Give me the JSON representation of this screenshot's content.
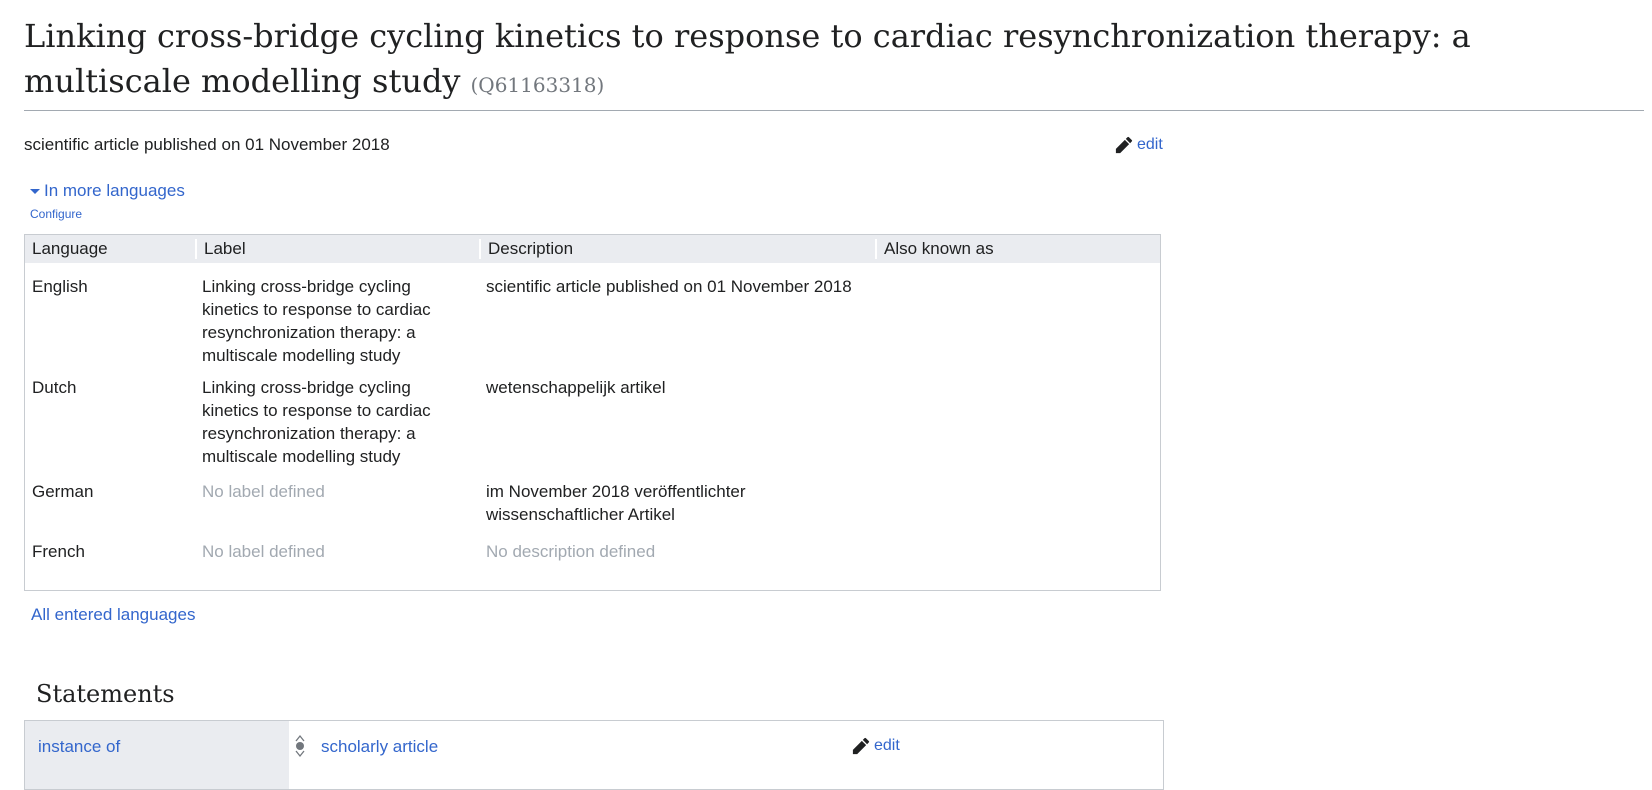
{
  "page": {
    "title": "Linking cross-bridge cycling kinetics to response to cardiac resynchronization therapy: a multiscale modelling study",
    "qid": "(Q61163318)",
    "description": "scientific article published on 01 November 2018",
    "edit_label": "edit"
  },
  "languages": {
    "toggle_label": "In more languages",
    "configure_label": "Configure",
    "headers": {
      "language": "Language",
      "label": "Label",
      "description": "Description",
      "aliases": "Also known as"
    },
    "rows": [
      {
        "language": "English",
        "label": "Linking cross-bridge cycling kinetics to response to cardiac resynchronization therapy: a multiscale modelling study",
        "description": "scientific article published on 01 November 2018",
        "aliases": ""
      },
      {
        "language": "Dutch",
        "label": "Linking cross-bridge cycling kinetics to response to cardiac resynchronization therapy: a multiscale modelling study",
        "description": "wetenschappelijk artikel",
        "aliases": ""
      },
      {
        "language": "German",
        "label": "No label defined",
        "description": "im November 2018 veröffentlichter wissenschaftlicher Artikel",
        "aliases": ""
      },
      {
        "language": "French",
        "label": "No label defined",
        "description": "No description defined",
        "aliases": ""
      }
    ],
    "all_languages_label": "All entered languages"
  },
  "statements": {
    "heading": "Statements",
    "items": [
      {
        "property": "instance of",
        "value": "scholarly article",
        "edit_label": "edit"
      }
    ]
  },
  "icons": {
    "edit": "pencil-icon",
    "toggle": "caret-down-icon",
    "rank": "rank-selector-icon"
  },
  "colors": {
    "link": "#3366cc",
    "muted": "#a2a9b1",
    "header_bg": "#eaecf0",
    "border": "#c8ccd1"
  }
}
